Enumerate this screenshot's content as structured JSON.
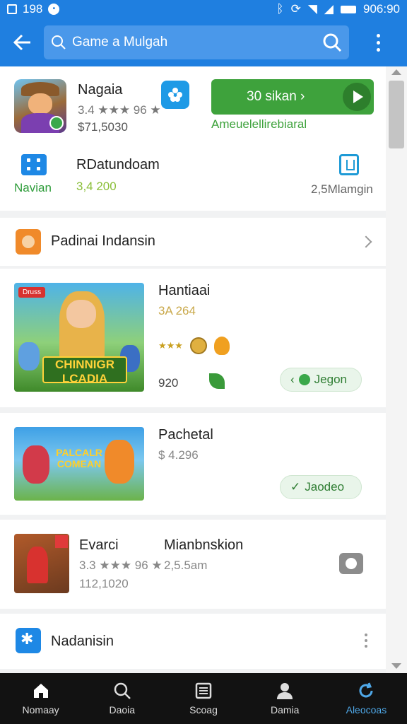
{
  "status_bar": {
    "left_text": "198",
    "time": "906:90"
  },
  "app_bar": {
    "search_text": "Game a Mulgah"
  },
  "hero": {
    "name": "Nagaia",
    "rating": "3.4 ★★★ 96 ★",
    "price": "$71,5030",
    "install_label": "30 sikan ›",
    "note": "Ameuelellirebiaral",
    "stat_left_label": "Navian",
    "stat_mid_title": "RDatundoam",
    "stat_mid_value": "3,4 200",
    "stat_right_label": "2,5Mlamgin"
  },
  "section1": {
    "title": "Padinai Indansin"
  },
  "games": [
    {
      "title": "Hantiaai",
      "sub": "3A 264",
      "tag": "Druss",
      "banner": "CHINNIGR LCADIA",
      "count": "920",
      "pill_label": "Jegon"
    },
    {
      "title": "Pachetal",
      "sub": "$ 4.296",
      "logo": "PALCALR COMEAN",
      "pill_label": "Jaodeo"
    },
    {
      "title": "Evarci",
      "rating": "3.3 ★★★ 96 ★",
      "price": "112,1020",
      "title2": "Mianbnskion",
      "size": "2,5.5am"
    }
  ],
  "section2": {
    "title": "Nadanisin"
  },
  "bottom_nav": [
    {
      "label": "Nomaay",
      "icon": "home-icon"
    },
    {
      "label": "Daoia",
      "icon": "search-icon"
    },
    {
      "label": "Scoag",
      "icon": "list-icon"
    },
    {
      "label": "Damia",
      "icon": "person-icon"
    },
    {
      "label": "Aleocoas",
      "icon": "refresh-icon"
    }
  ],
  "colors": {
    "primary": "#1f7fe0",
    "install_green": "#3ea23c",
    "nav_bg": "#121212",
    "nav_active": "#4fa8e8"
  }
}
